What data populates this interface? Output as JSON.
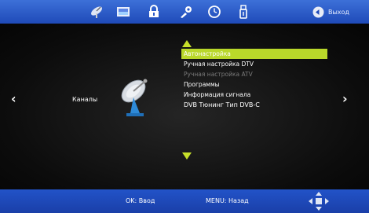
{
  "top_icons": [
    {
      "name": "satellite-icon"
    },
    {
      "name": "picture-icon"
    },
    {
      "name": "lock-icon"
    },
    {
      "name": "settings-icon"
    },
    {
      "name": "time-icon"
    },
    {
      "name": "usb-icon"
    }
  ],
  "header": {
    "exit_label": "Выход"
  },
  "section": {
    "label": "Каналы"
  },
  "menu": {
    "items": [
      {
        "label": "Автонастройка",
        "state": "selected"
      },
      {
        "label": "Ручная настройка DTV",
        "state": "normal"
      },
      {
        "label": "Ручная настройка ATV",
        "state": "disabled"
      },
      {
        "label": "Программы",
        "state": "normal"
      },
      {
        "label": "Информация сигнала",
        "state": "normal"
      },
      {
        "label": "DVB Тюнинг Тип DVB-C",
        "state": "normal"
      }
    ]
  },
  "footer": {
    "ok_hint": "OK: Ввод",
    "menu_hint": "MENU: Назад"
  },
  "colors": {
    "bar_blue": "#2253c8",
    "highlight": "#b9d82a",
    "arrow": "#c7e02a"
  }
}
